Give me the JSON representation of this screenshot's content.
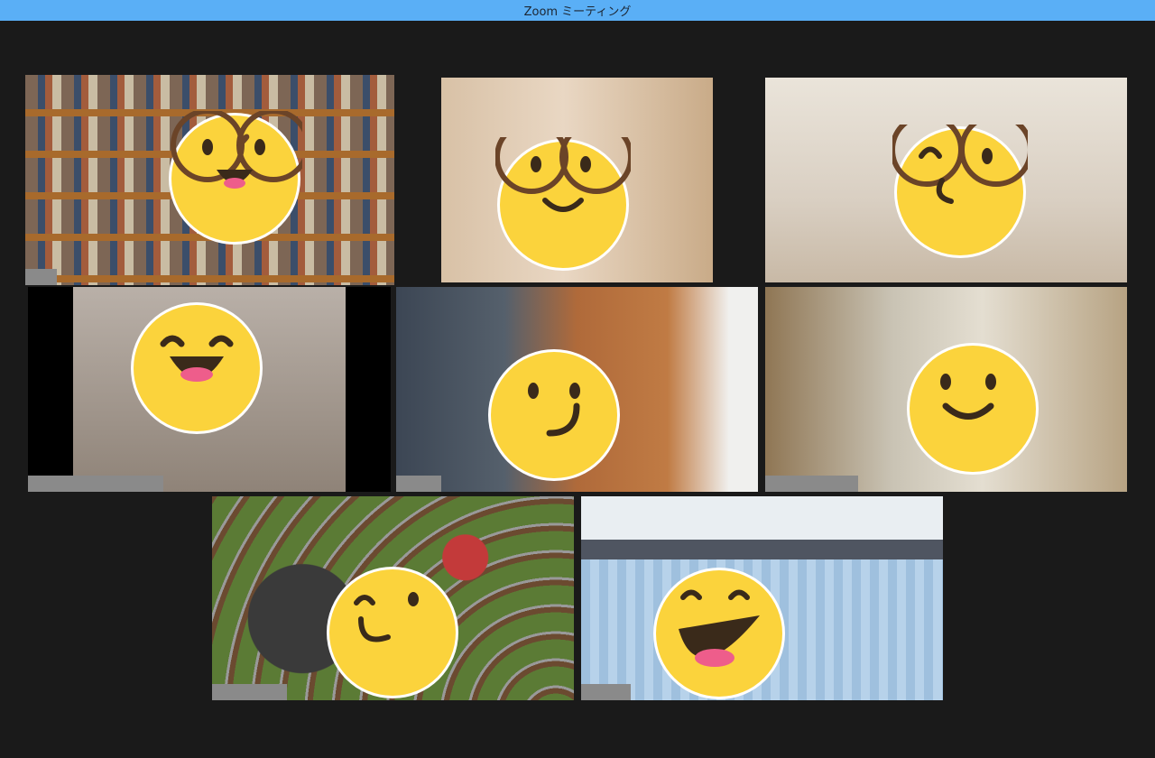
{
  "window": {
    "title": "Zoom ミーティング"
  },
  "gallery": {
    "tiles": [
      {
        "id": "p1",
        "active": true,
        "emoji": "glasses-grin"
      },
      {
        "id": "p2",
        "active": false,
        "emoji": "glasses-smile"
      },
      {
        "id": "p3",
        "active": false,
        "emoji": "glasses-wink"
      },
      {
        "id": "p4",
        "active": false,
        "emoji": "big-smile"
      },
      {
        "id": "p5",
        "active": false,
        "emoji": "smirk"
      },
      {
        "id": "p6",
        "active": false,
        "emoji": "smile"
      },
      {
        "id": "p7",
        "active": false,
        "emoji": "smirk"
      },
      {
        "id": "p8",
        "active": false,
        "emoji": "laugh"
      }
    ]
  },
  "colors": {
    "titlebar": "#5aaff6",
    "background": "#1a1a1a",
    "active_speaker_border": "#d9ee5a",
    "name_label": "#8a8a8a"
  }
}
